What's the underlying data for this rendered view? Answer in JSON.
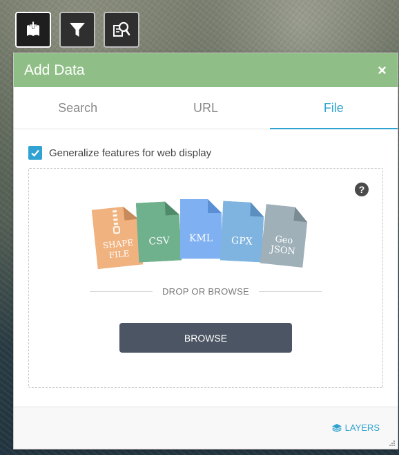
{
  "toolbar": {
    "buttons": [
      {
        "icon": "add-data-icon",
        "active": true
      },
      {
        "icon": "filter-icon",
        "active": false
      },
      {
        "icon": "query-icon",
        "active": false
      }
    ]
  },
  "panel": {
    "title": "Add Data",
    "close_label": "×",
    "tabs": [
      {
        "label": "Search",
        "active": false
      },
      {
        "label": "URL",
        "active": false
      },
      {
        "label": "File",
        "active": true
      }
    ],
    "generalize": {
      "checked": true,
      "label": "Generalize features for web display"
    },
    "help_label": "?",
    "file_types": [
      {
        "label_lines": [
          "SHAPE",
          "FILE"
        ],
        "color": "#f0b27f",
        "zipper": true
      },
      {
        "label_lines": [
          "CSV"
        ],
        "color": "#6fb08d"
      },
      {
        "label_lines": [
          "KML"
        ],
        "color": "#7fb0f2"
      },
      {
        "label_lines": [
          "GPX"
        ],
        "color": "#7fb3e0"
      },
      {
        "label_lines": [
          "Geo",
          "JSON"
        ],
        "color": "#9fb0b8"
      }
    ],
    "drop_text": "DROP OR BROWSE",
    "browse_label": "BROWSE",
    "layers_label": "LAYERS"
  },
  "colors": {
    "header": "#8fbf86",
    "accent": "#2fa3cf",
    "browse_button": "#4b5563"
  }
}
